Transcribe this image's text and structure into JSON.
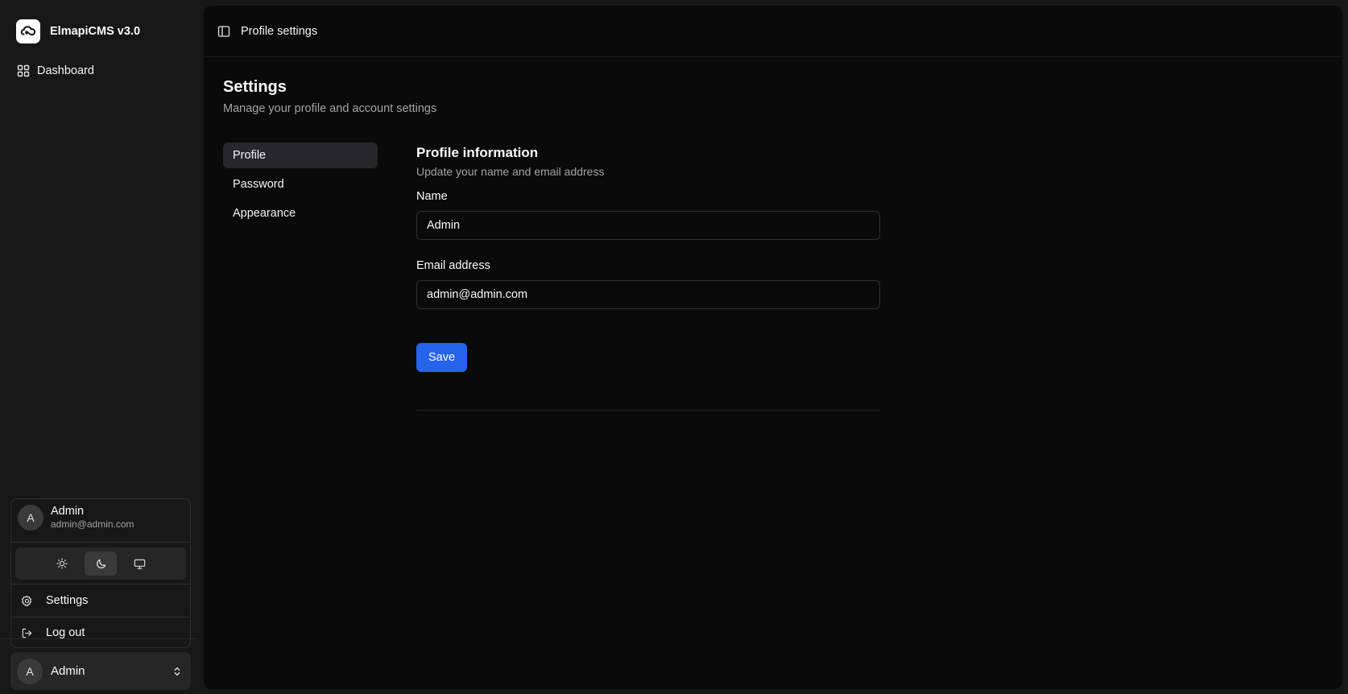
{
  "brand": {
    "name": "ElmapiCMS v3.0"
  },
  "sidebar": {
    "items": [
      {
        "label": "Dashboard",
        "icon": "grid-icon"
      }
    ]
  },
  "user": {
    "name": "Admin",
    "email": "admin@admin.com",
    "initial": "A"
  },
  "user_menu": {
    "theme_options": [
      "light",
      "dark",
      "system"
    ],
    "theme_selected": "dark",
    "items": [
      {
        "label": "Settings",
        "icon": "gear-icon"
      },
      {
        "label": "Log out",
        "icon": "logout-icon"
      }
    ]
  },
  "topbar": {
    "title": "Profile settings"
  },
  "page": {
    "title": "Settings",
    "subtitle": "Manage your profile and account settings"
  },
  "settings_nav": {
    "items": [
      {
        "label": "Profile",
        "active": true
      },
      {
        "label": "Password",
        "active": false
      },
      {
        "label": "Appearance",
        "active": false
      }
    ]
  },
  "profile_form": {
    "title": "Profile information",
    "subtitle": "Update your name and email address",
    "name_label": "Name",
    "name_value": "Admin",
    "email_label": "Email address",
    "email_value": "admin@admin.com",
    "save_label": "Save"
  },
  "colors": {
    "accent": "#2563eb",
    "background": "#0a0a0b",
    "sidebar": "#171717"
  }
}
